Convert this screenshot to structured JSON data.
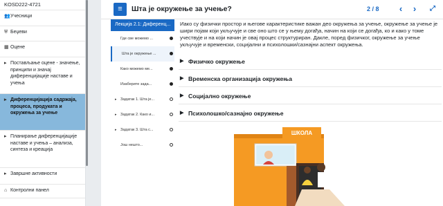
{
  "course_nav": {
    "course_code": "KOSD222-4721",
    "items": [
      {
        "icon": "users-icon",
        "glyph": "👥",
        "label": "Учесници",
        "active": false
      },
      {
        "icon": "badge-icon",
        "glyph": "⛨",
        "label": "Беџеви",
        "active": false
      },
      {
        "icon": "grades-icon",
        "glyph": "▦",
        "label": "Оцене",
        "active": false
      },
      {
        "icon": "folder-icon",
        "glyph": "▸",
        "label": "Постављање оцене - значење, принципи и значај диференцијације наставе и учења",
        "active": false
      },
      {
        "icon": "folder-icon",
        "glyph": "▸",
        "label": "Диференцијација садржаја, процеса, продуката и окружења за учење",
        "active": true
      },
      {
        "icon": "folder-icon",
        "glyph": "▸",
        "label": "Планирање диференцијације наставе и учења – анализа, синтеза и креација",
        "active": false
      },
      {
        "icon": "folder-icon",
        "glyph": "▸",
        "label": "Завршне активности",
        "active": false
      },
      {
        "icon": "dashboard-icon",
        "glyph": "⌂",
        "label": "Контролни панел",
        "active": false
      }
    ]
  },
  "lesson": {
    "title": "Шта је окружење за учење?",
    "page_counter": "2 / 8",
    "menu_glyph": "≡",
    "prev_glyph": "‹",
    "next_glyph": "›",
    "fullscreen_glyph": "⤢"
  },
  "toc": {
    "header": "Лекција 2.1: Диференц...",
    "items": [
      {
        "label": "Где све можемо ...",
        "arrow": "",
        "state": "done",
        "selected": false
      },
      {
        "label": "Шта је окружење ...",
        "arrow": "",
        "state": "done",
        "selected": true
      },
      {
        "label": "Како можемо ме...",
        "arrow": "",
        "state": "done",
        "selected": false
      },
      {
        "label": "Изаберите зада...",
        "arrow": "",
        "state": "done",
        "selected": false
      },
      {
        "label": "Задатак 1. Шта је...",
        "arrow": "▸",
        "state": "open",
        "selected": false
      },
      {
        "label": "Задатак 2. Како и...",
        "arrow": "▸",
        "state": "open",
        "selected": false
      },
      {
        "label": "Задатак 3. Шта с...",
        "arrow": "▸",
        "state": "open",
        "selected": false
      },
      {
        "label": "Још нешто...",
        "arrow": "",
        "state": "open",
        "selected": false
      }
    ]
  },
  "content": {
    "intro": "Иако су физички простор и његове карактеристике важан део окружења за учење, окружење за учење је шири појам који укључује и све оно што се у њему догађа, начин на који се догађа, ко и како у томе учествује и на који начин је овај процес структуриран. Дакле, поред физичког, окружење за учење укључује и временски, социјални и психолошки/сазнајни аспект окружења.",
    "sections": [
      "Физичко окружење",
      "Временска организација окружења",
      "Социјално окружење",
      "Психолошко/сазнајно окружење"
    ],
    "illustration_sign": "ШКОЛА"
  },
  "colors": {
    "accent": "#1a69c4",
    "active_nav": "#87b8dc",
    "school_orange": "#f59a23"
  }
}
